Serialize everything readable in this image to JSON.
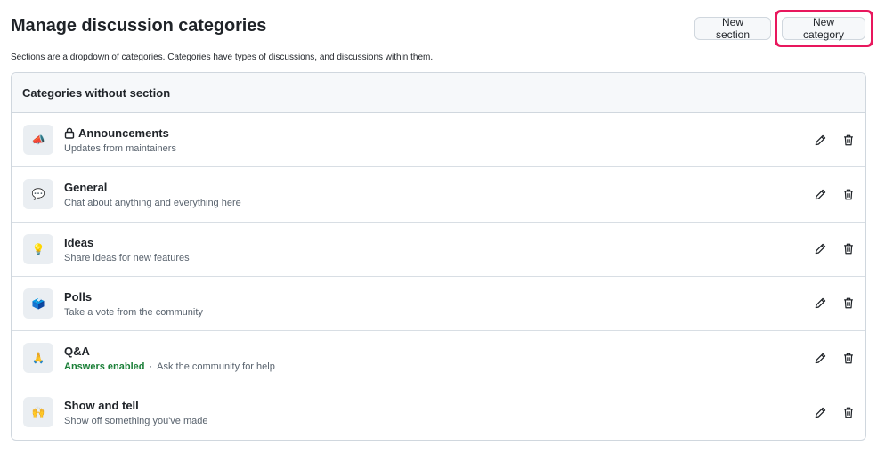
{
  "page": {
    "title": "Manage discussion categories",
    "subtitle": "Sections are a dropdown of categories. Categories have types of discussions, and discussions within them."
  },
  "toolbar": {
    "new_section_label": "New section",
    "new_category_label": "New category",
    "highlight_color": "#e8175d"
  },
  "panel": {
    "header": "Categories without section"
  },
  "categories": [
    {
      "emoji": "📣",
      "name": "Announcements",
      "locked": true,
      "description": "Updates from maintainers"
    },
    {
      "emoji": "💬",
      "name": "General",
      "locked": false,
      "description": "Chat about anything and everything here"
    },
    {
      "emoji": "💡",
      "name": "Ideas",
      "locked": false,
      "description": "Share ideas for new features"
    },
    {
      "emoji": "🗳️",
      "name": "Polls",
      "locked": false,
      "description": "Take a vote from the community"
    },
    {
      "emoji": "🙏",
      "name": "Q&A",
      "locked": false,
      "badge": "Answers enabled",
      "separator": "·",
      "description": "Ask the community for help"
    },
    {
      "emoji": "🙌",
      "name": "Show and tell",
      "locked": false,
      "description": "Show off something you've made"
    }
  ],
  "icons": {
    "lock": "lock-icon",
    "edit": "pencil-icon",
    "delete": "trash-icon"
  }
}
